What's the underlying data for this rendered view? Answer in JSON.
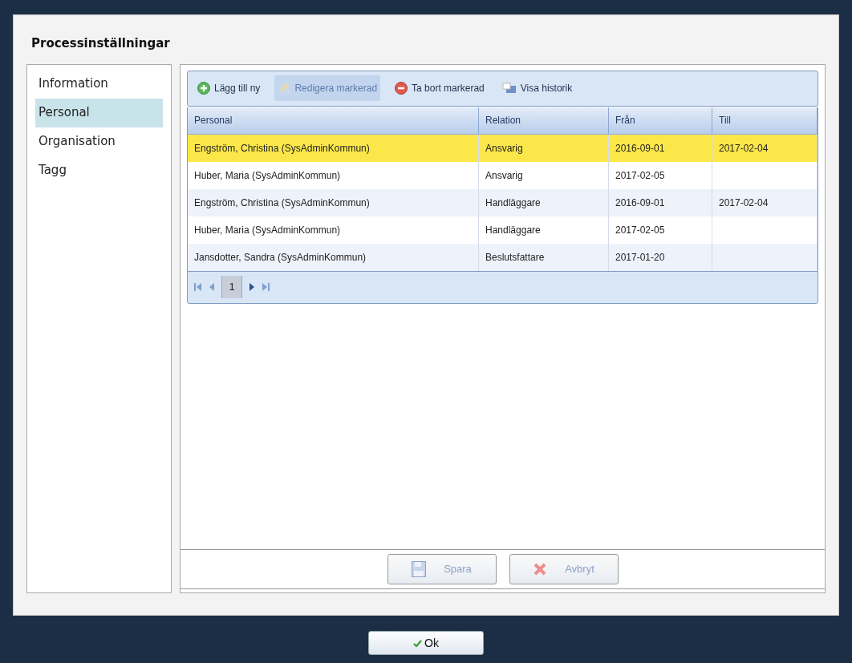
{
  "dialog": {
    "title": "Processinställningar"
  },
  "sidebar": {
    "items": [
      {
        "label": "Information",
        "selected": false
      },
      {
        "label": "Personal",
        "selected": true
      },
      {
        "label": "Organisation",
        "selected": false
      },
      {
        "label": "Tagg",
        "selected": false
      }
    ]
  },
  "toolbar": [
    {
      "kind": "add",
      "label": "Lägg till ny",
      "disabled": false
    },
    {
      "kind": "edit",
      "label": "Redigera markerad",
      "disabled": true
    },
    {
      "kind": "delete",
      "label": "Ta bort markerad",
      "disabled": false
    },
    {
      "kind": "history",
      "label": "Visa historik",
      "disabled": false
    }
  ],
  "table": {
    "columns": [
      "Personal",
      "Relation",
      "Från",
      "Till"
    ],
    "rows": [
      {
        "cells": [
          "Engström, Christina (SysAdminKommun)",
          "Ansvarig",
          "2016-09-01",
          "2017-02-04"
        ],
        "selected": true
      },
      {
        "cells": [
          "Huber, Maria (SysAdminKommun)",
          "Ansvarig",
          "2017-02-05",
          ""
        ],
        "selected": false
      },
      {
        "cells": [
          "Engström, Christina (SysAdminKommun)",
          "Handläggare",
          "2016-09-01",
          "2017-02-04"
        ],
        "selected": false
      },
      {
        "cells": [
          "Huber, Maria (SysAdminKommun)",
          "Handläggare",
          "2017-02-05",
          ""
        ],
        "selected": false
      },
      {
        "cells": [
          "Jansdotter, Sandra (SysAdminKommun)",
          "Beslutsfattare",
          "2017-01-20",
          ""
        ],
        "selected": false
      }
    ]
  },
  "pager": {
    "pages": [
      {
        "label": "1",
        "selected": true
      }
    ]
  },
  "actions": [
    {
      "kind": "save",
      "label": "Spara",
      "disabled": true
    },
    {
      "kind": "cancel",
      "label": "Avbryt",
      "disabled": true
    }
  ],
  "footer": {
    "ok_label": "Ok"
  }
}
